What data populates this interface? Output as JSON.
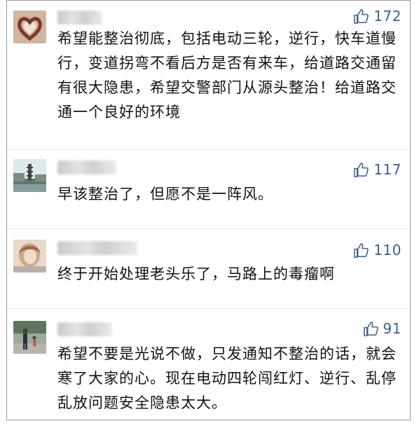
{
  "comments": [
    {
      "avatar": "hands-heart-avatar",
      "likes": "172",
      "text": "希望能整治彻底，包括电动三轮，逆行，快车道慢行，变道拐弯不看后方是否有来车，给道路交通留有很大隐患，希望交警部门从源头整治！给道路交通一个良好的环境"
    },
    {
      "avatar": "pagoda-scene-avatar",
      "likes": "117",
      "text": "早该整治了，但愿不是一阵风。"
    },
    {
      "avatar": "portrait-avatar",
      "likes": "110",
      "text": "终于开始处理老头乐了，马路上的毒瘤啊"
    },
    {
      "avatar": "street-people-avatar",
      "likes": "91",
      "text": "希望不要是光说不做，只发通知不整治的话，就会寒了大家的心。现在电动四轮闯红灯、逆行、乱停乱放问题安全隐患太大。"
    }
  ],
  "icons": {
    "like": "thumbs-up-icon"
  },
  "colors": {
    "like_count": "#3e5f8c",
    "text": "#111111",
    "border": "#9a9a9a"
  }
}
